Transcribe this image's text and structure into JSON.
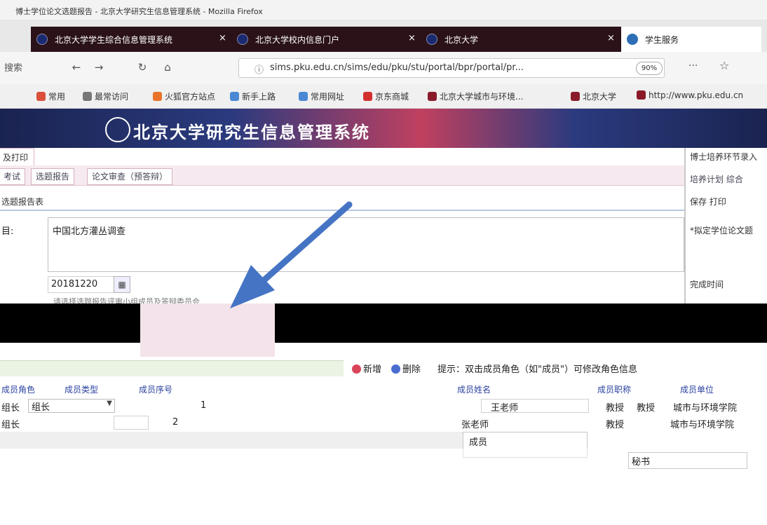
{
  "browser": {
    "window_title": "博士学位论文选题报告 - 北京大学研究生信息管理系统 - Mozilla Firefox",
    "tabs": [
      {
        "label": "北京大学学生综合信息管理系统",
        "close": "×",
        "active": false
      },
      {
        "label": "北京大学校内信息门户",
        "close": "×",
        "active": false
      },
      {
        "label": "北京大学",
        "close": "×",
        "active": false
      },
      {
        "label": "学生服务",
        "close": "×",
        "active": true
      }
    ],
    "nav": {
      "back_icon": "back-arrow-icon",
      "forward_icon": "forward-arrow-icon",
      "reload_icon": "reload-icon",
      "home_icon": "home-icon",
      "search_placeholder": "搜索",
      "url": "sims.pku.edu.cn/sims/edu/pku/stu/portal/bpr/portal/pr...",
      "zoom": "90%",
      "more": "···",
      "star_icon": "star-icon"
    },
    "bookmarks": [
      {
        "label": "常用",
        "color": "#d94f3b"
      },
      {
        "label": "最常访问",
        "color": "#777777"
      },
      {
        "label": "火狐官方站点",
        "color": "#e8742c"
      },
      {
        "label": "新手上路",
        "color": "#4a88d6"
      },
      {
        "label": "常用网址",
        "color": "#4a88d6"
      },
      {
        "label": "京东商城",
        "color": "#d22f2f"
      },
      {
        "label": "北京大学城市与环境...",
        "color": "#8a1a2a"
      },
      {
        "label": "北京大学",
        "color": "#8a1a2a"
      },
      {
        "label": "http://www.pku.edu.cn",
        "color": "#8a1a2a"
      }
    ],
    "banner_title": "北京大学研究生信息管理系统"
  },
  "app": {
    "left_tab": "及打印",
    "page_tabs": [
      "考试",
      "选题报告",
      "论文审查（预答辩）"
    ],
    "form_title": "选题报告表",
    "field_title_label": "目:",
    "thesis_title": "中国北方灌丛调查",
    "date_value": "20181220",
    "hidden_sub": "请选择选题报告评审小组成员及答辩委员会",
    "right_pane": {
      "title": "博士培养环节录入",
      "tabs": "培养计划  综合",
      "tools": "保存  打印",
      "label_title": "*拟定学位论文题",
      "label_time": "完成时间"
    },
    "team_toolbar": {
      "add_label": "新增",
      "delete_label": "删除",
      "hint": "提示：双击成员角色（如\"成员\"）可修改角色信息"
    },
    "left_headers": [
      "成员角色",
      "成员类型",
      "成员序号"
    ],
    "right_headers": [
      "成员姓名",
      "成员职称",
      "成员单位"
    ],
    "left_rows": [
      {
        "role": "组长",
        "dropdown": "组长",
        "seq": "1"
      },
      {
        "role": "组长",
        "dropdown": "",
        "seq": "2"
      }
    ],
    "right_rows": [
      {
        "name": "王老师",
        "title": "教授",
        "title2": "教授",
        "unit": "城市与环境学院"
      },
      {
        "name": "张老师",
        "title": "教授",
        "title2": "",
        "unit": "城市与环境学院"
      }
    ],
    "popup_role": "成员",
    "popup_role2": "秘书"
  }
}
